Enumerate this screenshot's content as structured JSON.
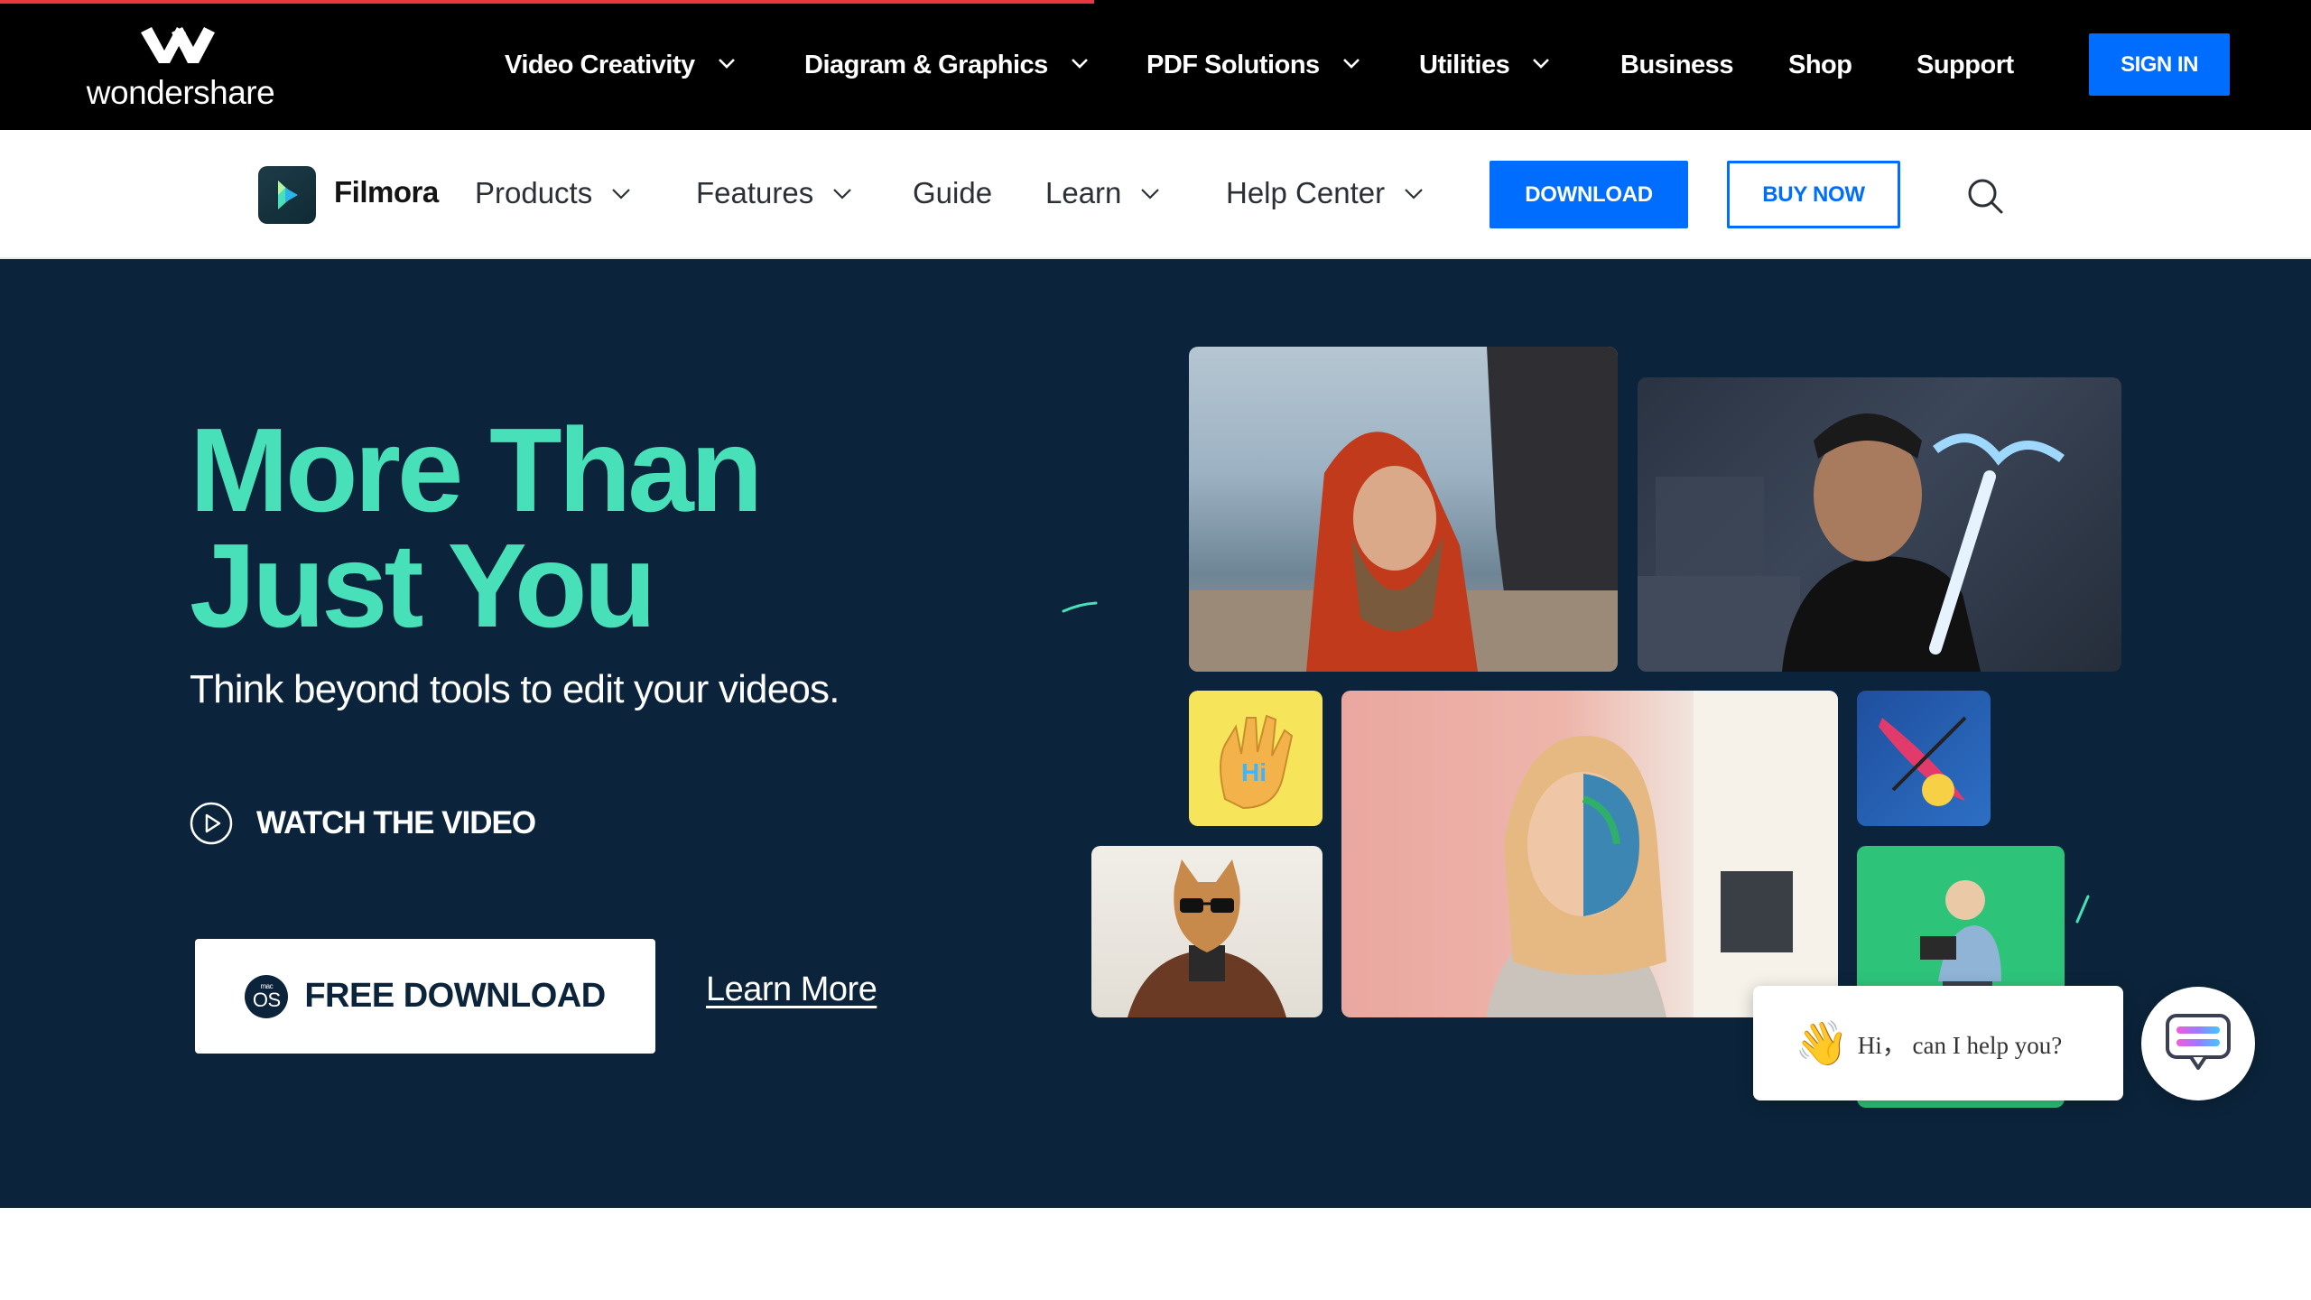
{
  "top_nav": {
    "brand": "wondershare",
    "items": [
      {
        "label": "Video Creativity",
        "dropdown": true
      },
      {
        "label": "Diagram & Graphics",
        "dropdown": true
      },
      {
        "label": "PDF Solutions",
        "dropdown": true
      },
      {
        "label": "Utilities",
        "dropdown": true
      },
      {
        "label": "Business",
        "dropdown": false
      },
      {
        "label": "Shop",
        "dropdown": false
      },
      {
        "label": "Support",
        "dropdown": false
      }
    ],
    "sign_in": "SIGN IN"
  },
  "product_nav": {
    "product_name": "Filmora",
    "items": [
      {
        "label": "Products",
        "dropdown": true
      },
      {
        "label": "Features",
        "dropdown": true
      },
      {
        "label": "Guide",
        "dropdown": false
      },
      {
        "label": "Learn",
        "dropdown": true
      },
      {
        "label": "Help Center",
        "dropdown": true
      }
    ],
    "download": "DOWNLOAD",
    "buy_now": "BUY NOW",
    "search_icon": "search-icon"
  },
  "hero": {
    "title_line1": "More Than",
    "title_line2": "Just You",
    "subtitle": "Think beyond tools to edit your videos.",
    "watch_video": "WATCH THE VIDEO",
    "free_download": "FREE DOWNLOAD",
    "os_badge_small": "mac",
    "os_badge": "OS",
    "learn_more": "Learn More"
  },
  "chat": {
    "greeting": "Hi， can I help you?",
    "wave_icon": "waving-hand-icon",
    "chat_icon": "chat-icon"
  },
  "colors": {
    "top_bar": "#000000",
    "accent_blue": "#006dff",
    "hero_bg": "#0b243b",
    "hero_title": "#48e0b8",
    "progress_red": "#e8383d"
  }
}
